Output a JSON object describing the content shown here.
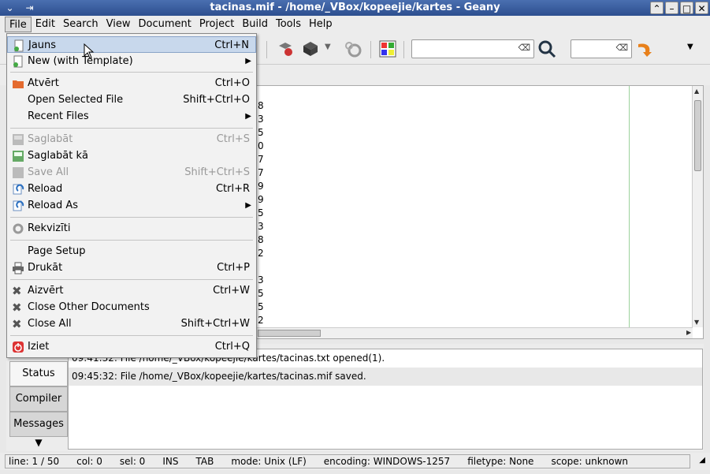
{
  "window": {
    "title": "tacinas.mif - /home/_VBox/kopeejie/kartes - Geany"
  },
  "menubar": [
    "File",
    "Edit",
    "Search",
    "View",
    "Document",
    "Project",
    "Build",
    "Tools",
    "Help"
  ],
  "file_menu": [
    {
      "label": "Jauns",
      "accel": "Ctrl+N",
      "icon": "new-file-icon",
      "disabled": false,
      "highlight": true
    },
    {
      "label": "New (with Template)",
      "accel": "",
      "icon": "new-file-icon",
      "submenu": true
    },
    {
      "sep": true
    },
    {
      "label": "Atvērt",
      "accel": "Ctrl+O",
      "icon": "open-folder-icon"
    },
    {
      "label": "Open Selected File",
      "accel": "Shift+Ctrl+O",
      "icon": ""
    },
    {
      "label": "Recent Files",
      "accel": "",
      "icon": "",
      "submenu": true
    },
    {
      "sep": true
    },
    {
      "label": "Saglabāt",
      "accel": "Ctrl+S",
      "icon": "save-icon",
      "disabled": true
    },
    {
      "label": "Saglabāt kā",
      "accel": "",
      "icon": "save-as-icon"
    },
    {
      "label": "Save All",
      "accel": "Shift+Ctrl+S",
      "icon": "save-all-icon",
      "disabled": true
    },
    {
      "label": "Reload",
      "accel": "Ctrl+R",
      "icon": "reload-icon"
    },
    {
      "label": "Reload As",
      "accel": "",
      "icon": "reload-icon",
      "submenu": true
    },
    {
      "sep": true
    },
    {
      "label": "Rekvizīti",
      "accel": "",
      "icon": "gear-icon"
    },
    {
      "sep": true
    },
    {
      "label": "Page Setup",
      "accel": "",
      "icon": ""
    },
    {
      "label": "Drukāt",
      "accel": "Ctrl+P",
      "icon": "print-icon"
    },
    {
      "sep": true
    },
    {
      "label": "Aizvērt",
      "accel": "Ctrl+W",
      "icon": "close-icon"
    },
    {
      "label": "Close Other Documents",
      "accel": "",
      "icon": "close-icon"
    },
    {
      "label": "Close All",
      "accel": "Shift+Ctrl+W",
      "icon": "close-icon"
    },
    {
      "sep": true
    },
    {
      "label": "Iziet",
      "accel": "Ctrl+Q",
      "icon": "quit-icon"
    }
  ],
  "editor": {
    "line_digits": [
      "8",
      "3",
      "5",
      "0",
      "7",
      "7",
      "9",
      "9",
      "5",
      "3",
      "8",
      "2",
      "",
      "3",
      "5",
      "5",
      "2"
    ]
  },
  "side_tabs": [
    "Status",
    "Compiler",
    "Messages"
  ],
  "messages": [
    "09:41:32: File /home/_VBox/kopeejie/kartes/tacinas.txt opened(1).",
    "09:45:32: File /home/_VBox/kopeejie/kartes/tacinas.mif saved."
  ],
  "status": {
    "line": "line: 1 / 50",
    "col": "col: 0",
    "sel": "sel: 0",
    "ins": "INS",
    "tab": "TAB",
    "mode": "mode: Unix (LF)",
    "encoding": "encoding: WINDOWS-1257",
    "filetype": "filetype: None",
    "scope": "scope: unknown"
  },
  "colors": {
    "titlebar": "#3a5fa0",
    "highlight": "#c8d8ec"
  }
}
